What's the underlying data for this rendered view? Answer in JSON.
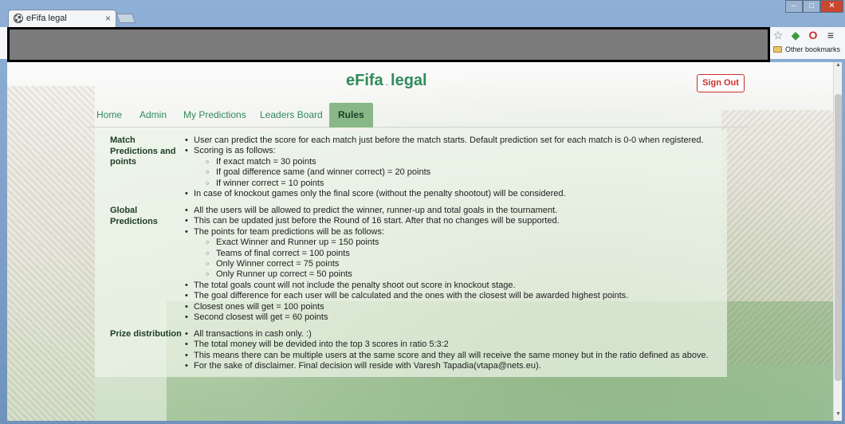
{
  "browser": {
    "tab_title": "eFifa legal",
    "tab_favicon": "soccer-ball-icon",
    "bookmarks": {
      "other_label": "Other bookmarks"
    }
  },
  "page": {
    "brand_main": "eFifa",
    "brand_sub": "..",
    "brand_tail": "legal",
    "signout_label": "Sign Out",
    "nav": [
      {
        "label": "Home"
      },
      {
        "label": "Admin"
      },
      {
        "label": "My Predictions"
      },
      {
        "label": "Leaders Board"
      },
      {
        "label": "Rules",
        "active": true
      }
    ],
    "sections": [
      {
        "title": "Match Predictions and points",
        "items": [
          {
            "level": 1,
            "text": "User can predict the score for each match just before the match starts. Default prediction set for each match is 0-0 when registered."
          },
          {
            "level": 1,
            "text": "Scoring is as follows:"
          },
          {
            "level": 2,
            "text": "If exact match = 30 points"
          },
          {
            "level": 2,
            "text": "If goal difference same (and winner correct) = 20 points"
          },
          {
            "level": 2,
            "text": "If winner correct = 10 points"
          },
          {
            "level": 1,
            "text": "In case of knockout games only the final score (without the penalty shootout) will be considered."
          }
        ]
      },
      {
        "title": "Global Predictions",
        "items": [
          {
            "level": 1,
            "text": "All the users will be allowed to predict the winner, runner-up and total goals in the tournament."
          },
          {
            "level": 1,
            "text": "This can be updated just before the Round of 16 start. After that no changes will be supported."
          },
          {
            "level": 1,
            "text": "The points for team predictions will be as follows:"
          },
          {
            "level": 2,
            "text": "Exact Winner and Runner up = 150 points"
          },
          {
            "level": 2,
            "text": "Teams of final correct = 100 points"
          },
          {
            "level": 2,
            "text": "Only Winner correct = 75 points"
          },
          {
            "level": 2,
            "text": "Only Runner up correct = 50 points"
          },
          {
            "level": 1,
            "text": "The total goals count will not include the penalty shoot out score in knockout stage."
          },
          {
            "level": 1,
            "text": "The goal difference for each user will be calculated and the ones with the closest will be awarded highest points."
          },
          {
            "level": 1,
            "text": "Closest ones will get = 100 points"
          },
          {
            "level": 1,
            "text": "Second closest will get = 60 points"
          }
        ]
      },
      {
        "title": "Prize distribution",
        "items": [
          {
            "level": 1,
            "text": "All transactions in cash only. :)"
          },
          {
            "level": 1,
            "text": "The total money will be devided into the top 3 scores in ratio 5:3:2"
          },
          {
            "level": 1,
            "text": "This means there can be multiple users at the same score and they all will receive the same money but in the ratio defined as above."
          },
          {
            "level": 1,
            "text": "For the sake of disclaimer. Final decision will reside with Varesh Tapadia(vtapa@nets.eu)."
          }
        ]
      }
    ]
  }
}
